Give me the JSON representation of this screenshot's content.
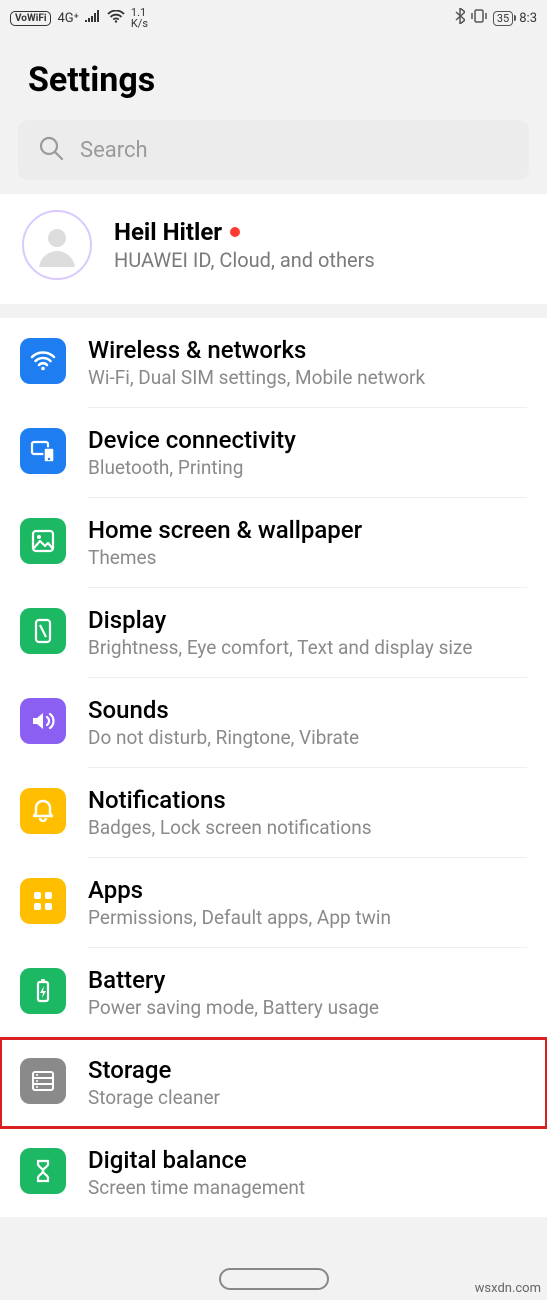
{
  "statusbar": {
    "vowifi": "VoWiFi",
    "signal": "4G⁺",
    "netspeed_line1": "1.1",
    "netspeed_line2": "K/s",
    "battery": "35",
    "time": "8:3"
  },
  "page": {
    "title": "Settings"
  },
  "search": {
    "placeholder": "Search"
  },
  "account": {
    "name": "Heil Hitler",
    "subtitle": "HUAWEI ID, Cloud, and others"
  },
  "items": [
    {
      "title": "Wireless & networks",
      "subtitle": "Wi-Fi, Dual SIM settings, Mobile network",
      "icon": "wifi-icon",
      "color": "#1e7df0"
    },
    {
      "title": "Device connectivity",
      "subtitle": "Bluetooth, Printing",
      "icon": "device-connectivity-icon",
      "color": "#1e7df0"
    },
    {
      "title": "Home screen & wallpaper",
      "subtitle": "Themes",
      "icon": "wallpaper-icon",
      "color": "#1db864"
    },
    {
      "title": "Display",
      "subtitle": "Brightness, Eye comfort, Text and display size",
      "icon": "display-icon",
      "color": "#1db864"
    },
    {
      "title": "Sounds",
      "subtitle": "Do not disturb, Ringtone, Vibrate",
      "icon": "sounds-icon",
      "color": "#8b5ff2"
    },
    {
      "title": "Notifications",
      "subtitle": "Badges, Lock screen notifications",
      "icon": "notifications-icon",
      "color": "#ffbf00"
    },
    {
      "title": "Apps",
      "subtitle": "Permissions, Default apps, App twin",
      "icon": "apps-icon",
      "color": "#ffbf00"
    },
    {
      "title": "Battery",
      "subtitle": "Power saving mode, Battery usage",
      "icon": "battery-icon",
      "color": "#1db864"
    },
    {
      "title": "Storage",
      "subtitle": "Storage cleaner",
      "icon": "storage-icon",
      "color": "#8a8a8a",
      "highlighted": true
    },
    {
      "title": "Digital balance",
      "subtitle": "Screen time management",
      "icon": "digital-balance-icon",
      "color": "#1db864"
    }
  ],
  "watermark": "wsxdn.com"
}
